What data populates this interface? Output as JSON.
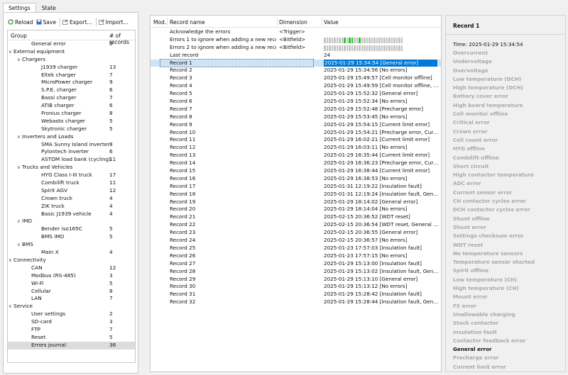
{
  "tabs": [
    {
      "label": "Settings",
      "active": true
    },
    {
      "label": "State",
      "active": false
    }
  ],
  "toolbar": {
    "reload": "Reload",
    "save": "Save",
    "export": "Export...",
    "import": "Import..."
  },
  "tree": {
    "col_group": "Group",
    "col_records": "# of records",
    "rows": [
      {
        "label": "General error",
        "value": "6",
        "level": 2,
        "expander": ""
      },
      {
        "label": "External equipment",
        "value": "",
        "level": 0,
        "expander": "v"
      },
      {
        "label": "Chargers",
        "value": "",
        "level": 1,
        "expander": "v"
      },
      {
        "label": "J1939 charger",
        "value": "13",
        "level": 3,
        "expander": ""
      },
      {
        "label": "Eltek charger",
        "value": "7",
        "level": 3,
        "expander": ""
      },
      {
        "label": "MicroPower charger",
        "value": "9",
        "level": 3,
        "expander": ""
      },
      {
        "label": "S.P.E. charger",
        "value": "6",
        "level": 3,
        "expander": ""
      },
      {
        "label": "Bassi charger",
        "value": "7",
        "level": 3,
        "expander": ""
      },
      {
        "label": "ATIB charger",
        "value": "6",
        "level": 3,
        "expander": ""
      },
      {
        "label": "Fronius charger",
        "value": "8",
        "level": 3,
        "expander": ""
      },
      {
        "label": "Webasto charger",
        "value": "5",
        "level": 3,
        "expander": ""
      },
      {
        "label": "Skytronic charger",
        "value": "5",
        "level": 3,
        "expander": ""
      },
      {
        "label": "Inverters and Loads",
        "value": "",
        "level": 1,
        "expander": "v"
      },
      {
        "label": "SMA Sunny Island inverter",
        "value": "8",
        "level": 3,
        "expander": ""
      },
      {
        "label": "Pylontech inverter",
        "value": "6",
        "level": 3,
        "expander": ""
      },
      {
        "label": "ASTOM load bank (cycling)",
        "value": "11",
        "level": 3,
        "expander": ""
      },
      {
        "label": "Trucks and Vehicles",
        "value": "",
        "level": 1,
        "expander": "v"
      },
      {
        "label": "HYG Class I-III truck",
        "value": "17",
        "level": 3,
        "expander": ""
      },
      {
        "label": "Combilift truck",
        "value": "11",
        "level": 3,
        "expander": ""
      },
      {
        "label": "Spirit AGV",
        "value": "12",
        "level": 3,
        "expander": ""
      },
      {
        "label": "Crown truck",
        "value": "4",
        "level": 3,
        "expander": ""
      },
      {
        "label": "ZiK truck",
        "value": "4",
        "level": 3,
        "expander": ""
      },
      {
        "label": "Basic J1939 vehicle",
        "value": "4",
        "level": 3,
        "expander": ""
      },
      {
        "label": "IMD",
        "value": "",
        "level": 1,
        "expander": "v"
      },
      {
        "label": "Bender iso165C",
        "value": "5",
        "level": 3,
        "expander": ""
      },
      {
        "label": "BMS IMD",
        "value": "5",
        "level": 3,
        "expander": ""
      },
      {
        "label": "BMS",
        "value": "",
        "level": 1,
        "expander": "v"
      },
      {
        "label": "Main X",
        "value": "4",
        "level": 3,
        "expander": ""
      },
      {
        "label": "Connectivity",
        "value": "",
        "level": 0,
        "expander": "v"
      },
      {
        "label": "CAN",
        "value": "12",
        "level": 2,
        "expander": ""
      },
      {
        "label": "Modbus (RS-485)",
        "value": "3",
        "level": 2,
        "expander": ""
      },
      {
        "label": "Wi-Fi",
        "value": "5",
        "level": 2,
        "expander": ""
      },
      {
        "label": "Cellular",
        "value": "8",
        "level": 2,
        "expander": ""
      },
      {
        "label": "LAN",
        "value": "7",
        "level": 2,
        "expander": ""
      },
      {
        "label": "Service",
        "value": "",
        "level": 0,
        "expander": "v"
      },
      {
        "label": "User settings",
        "value": "2",
        "level": 2,
        "expander": ""
      },
      {
        "label": "SD-card",
        "value": "3",
        "level": 2,
        "expander": ""
      },
      {
        "label": "FTP",
        "value": "7",
        "level": 2,
        "expander": ""
      },
      {
        "label": "Reset",
        "value": "5",
        "level": 2,
        "expander": ""
      },
      {
        "label": "Errors journal",
        "value": "36",
        "level": 2,
        "expander": "",
        "selected": true
      }
    ]
  },
  "main": {
    "col_mod": "Mod.",
    "col_name": "Record name",
    "col_dim": "Dimension",
    "col_value": "Value",
    "rows": [
      {
        "name": "Acknowledge the errors",
        "dim": "<Trigger>",
        "value": ""
      },
      {
        "name": "Errors 1 to ignore when adding a new record",
        "dim": "<Bitfield>",
        "value": "",
        "bits": [
          0,
          0,
          0,
          0,
          0,
          0,
          0,
          0,
          1,
          0,
          1,
          1,
          0,
          0,
          1,
          0,
          0,
          0,
          0,
          0,
          0,
          0,
          0,
          0,
          0,
          0,
          0,
          0,
          0,
          0,
          0,
          0
        ]
      },
      {
        "name": "Errors 2 to ignore when adding a new record",
        "dim": "<Bitfield>",
        "value": "",
        "bits": [
          0,
          0,
          0,
          0,
          0,
          0,
          0,
          0,
          0,
          0,
          0,
          0,
          0,
          0,
          0,
          0,
          0,
          0,
          0,
          0,
          0,
          0,
          0,
          0,
          0,
          0,
          0,
          0,
          0,
          0,
          0,
          0
        ]
      },
      {
        "name": "Last record",
        "dim": "",
        "value": "24"
      },
      {
        "name": "Record 1",
        "dim": "",
        "value": "2025-01-29 15:34:54 [General error]",
        "selected": true
      },
      {
        "name": "Record 2",
        "dim": "",
        "value": "2025-01-29 15:34:56 [No errors]"
      },
      {
        "name": "Record 3",
        "dim": "",
        "value": "2025-01-29 15:49:57 [Cell monitor offline]"
      },
      {
        "name": "Record 4",
        "dim": "",
        "value": "2025-01-29 15:49:59 [Cell monitor offline, Ge..."
      },
      {
        "name": "Record 5",
        "dim": "",
        "value": "2025-01-29 15:52:32 [General error]"
      },
      {
        "name": "Record 6",
        "dim": "",
        "value": "2025-01-29 15:52:34 [No errors]"
      },
      {
        "name": "Record 7",
        "dim": "",
        "value": "2025-01-29 15:52:48 [Precharge error]"
      },
      {
        "name": "Record 8",
        "dim": "",
        "value": "2025-01-29 15:53:45 [No errors]"
      },
      {
        "name": "Record 9",
        "dim": "",
        "value": "2025-01-29 15:54:15 [Current limit error]"
      },
      {
        "name": "Record 10",
        "dim": "",
        "value": "2025-01-29 15:54:21 [Precharge error, Curren..."
      },
      {
        "name": "Record 11",
        "dim": "",
        "value": "2025-01-29 16:02:21 [Current limit error]"
      },
      {
        "name": "Record 12",
        "dim": "",
        "value": "2025-01-29 16:03:11 [No errors]"
      },
      {
        "name": "Record 13",
        "dim": "",
        "value": "2025-01-29 16:35:44 [Current limit error]"
      },
      {
        "name": "Record 14",
        "dim": "",
        "value": "2025-01-29 16:36:23 [Precharge error, Curren..."
      },
      {
        "name": "Record 15",
        "dim": "",
        "value": "2025-01-29 16:38:44 [Current limit error]"
      },
      {
        "name": "Record 16",
        "dim": "",
        "value": "2025-01-29 16:38:53 [No errors]"
      },
      {
        "name": "Record 17",
        "dim": "",
        "value": "2025-01-31 12:19:22 [Insulation fault]"
      },
      {
        "name": "Record 18",
        "dim": "",
        "value": "2025-01-31 12:19:24 [Insulation fault, Genera..."
      },
      {
        "name": "Record 19",
        "dim": "",
        "value": "2025-01-29 18:14:02 [General error]"
      },
      {
        "name": "Record 20",
        "dim": "",
        "value": "2025-01-29 18:14:04 [No errors]"
      },
      {
        "name": "Record 21",
        "dim": "",
        "value": "2025-02-15 20:36:52 [WDT reset]"
      },
      {
        "name": "Record 22",
        "dim": "",
        "value": "2025-02-15 20:36:54 [WDT reset, General error]"
      },
      {
        "name": "Record 23",
        "dim": "",
        "value": "2025-02-15 20:36:55 [General error]"
      },
      {
        "name": "Record 24",
        "dim": "",
        "value": "2025-02-15 20:36:57 [No errors]"
      },
      {
        "name": "Record 25",
        "dim": "",
        "value": "2025-01-23 17:57:03 [Insulation fault]"
      },
      {
        "name": "Record 26",
        "dim": "",
        "value": "2025-01-23 17:57:15 [No errors]"
      },
      {
        "name": "Record 27",
        "dim": "",
        "value": "2025-01-29 15:13:00 [Insulation fault]"
      },
      {
        "name": "Record 28",
        "dim": "",
        "value": "2025-01-29 15:13:02 [Insulation fault, Genera..."
      },
      {
        "name": "Record 29",
        "dim": "",
        "value": "2025-01-29 15:13:10 [General error]"
      },
      {
        "name": "Record 30",
        "dim": "",
        "value": "2025-01-29 15:13:12 [No errors]"
      },
      {
        "name": "Record 31",
        "dim": "",
        "value": "2025-01-29 15:28:42 [Insulation fault]"
      },
      {
        "name": "Record 32",
        "dim": "",
        "value": "2025-01-29 15:28:44 [Insulation fault, Genera..."
      }
    ]
  },
  "detail": {
    "title": "Record 1",
    "time": "Time: 2025-01-29 15:34:54",
    "flags": [
      {
        "label": "Overcurrent",
        "active": false
      },
      {
        "label": "Undervoltage",
        "active": false
      },
      {
        "label": "Overvoltage",
        "active": false
      },
      {
        "label": "Low temperature (DCH)",
        "active": false
      },
      {
        "label": "High temperature (DCH)",
        "active": false
      },
      {
        "label": "Battery cover error",
        "active": false
      },
      {
        "label": "High board temperature",
        "active": false
      },
      {
        "label": "Cell monitor offline",
        "active": false
      },
      {
        "label": "Critical error",
        "active": false
      },
      {
        "label": "Crown error",
        "active": false
      },
      {
        "label": "Cell count error",
        "active": false
      },
      {
        "label": "HYG offline",
        "active": false
      },
      {
        "label": "Combilift offline",
        "active": false
      },
      {
        "label": "Short circuit",
        "active": false
      },
      {
        "label": "High contactor temperature",
        "active": false
      },
      {
        "label": "ADC error",
        "active": false
      },
      {
        "label": "Current sensor error",
        "active": false
      },
      {
        "label": "CH contactor cycles error",
        "active": false
      },
      {
        "label": "DCH contactor cycles error",
        "active": false
      },
      {
        "label": "Shunt offline",
        "active": false
      },
      {
        "label": "Shunt error",
        "active": false
      },
      {
        "label": "Settings checksum error",
        "active": false
      },
      {
        "label": "WDT reset",
        "active": false
      },
      {
        "label": "No temperature sensors",
        "active": false
      },
      {
        "label": "Temperature sensor shorted",
        "active": false
      },
      {
        "label": "Spirit offline",
        "active": false
      },
      {
        "label": "Low temperature (CH)",
        "active": false
      },
      {
        "label": "High temperature (CH)",
        "active": false
      },
      {
        "label": "Mount error",
        "active": false
      },
      {
        "label": "FS error",
        "active": false
      },
      {
        "label": "Unallowable charging",
        "active": false
      },
      {
        "label": "Stuck contactor",
        "active": false
      },
      {
        "label": "Insulation fault",
        "active": false
      },
      {
        "label": "Contactor feedback error",
        "active": false
      },
      {
        "label": "General error",
        "active": true
      },
      {
        "label": "Precharge error",
        "active": false
      },
      {
        "label": "Current limit error",
        "active": false
      }
    ]
  },
  "colors": {
    "accent": "#0078d7",
    "selected_row": "#cce4f7",
    "bit_on": "#2ec12e",
    "bit_off": "#c4c4c4",
    "flag_inactive": "#a9a9a9"
  }
}
